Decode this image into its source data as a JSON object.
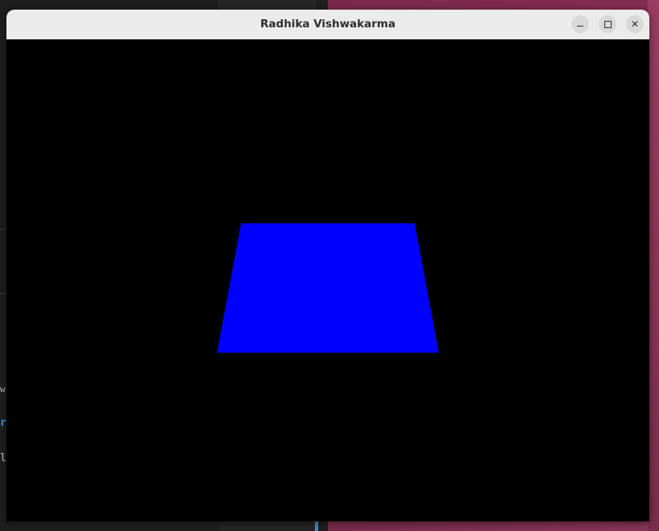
{
  "window": {
    "title": "Radhika Vishwakarma",
    "controls": {
      "minimize": "minimize",
      "maximize": "maximize",
      "close": "close"
    }
  },
  "canvas": {
    "background_color": "#000000",
    "shape": {
      "type": "trapezoid",
      "fill_color": "#0000ff"
    }
  },
  "background_fragments": {
    "line1": "w",
    "line2": "r",
    "line3": "l"
  }
}
